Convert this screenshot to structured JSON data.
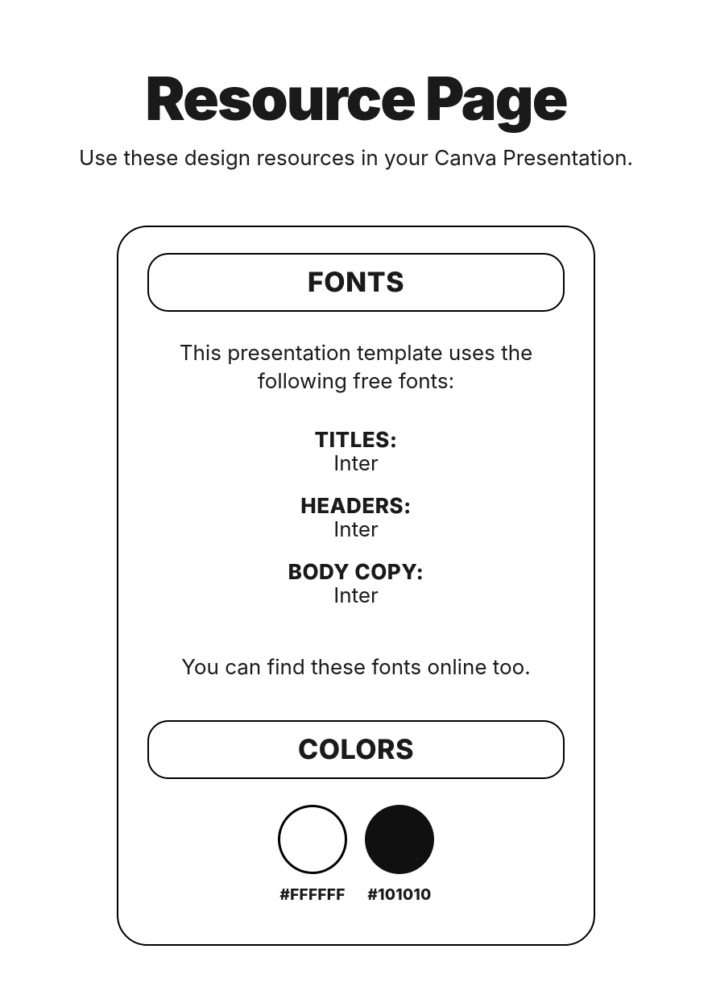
{
  "title": "Resource Page",
  "subtitle": "Use these design resources in your Canva Presentation.",
  "fonts": {
    "header": "FONTS",
    "intro": "This presentation template uses the following free fonts:",
    "items": [
      {
        "label": "TITLES:",
        "value": "Inter"
      },
      {
        "label": "HEADERS:",
        "value": "Inter"
      },
      {
        "label": "BODY COPY:",
        "value": "Inter"
      }
    ],
    "note": "You can find these fonts online too."
  },
  "colors": {
    "header": "COLORS",
    "swatches": [
      {
        "hex": "#FFFFFF",
        "class": "white"
      },
      {
        "hex": "#101010",
        "class": "black"
      }
    ]
  }
}
